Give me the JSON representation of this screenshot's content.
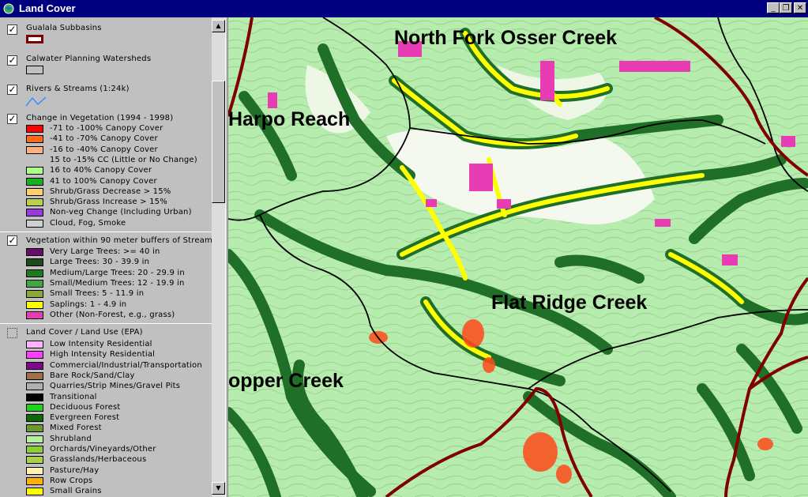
{
  "window": {
    "title": "Land Cover",
    "controls": [
      "_",
      "❐",
      "✕"
    ]
  },
  "legend": {
    "groups": [
      {
        "title": "Gualala Subbasins",
        "checked": true,
        "symbol": "subbasin-box",
        "color": "#800000"
      },
      {
        "title": "Calwater Planning Watersheds",
        "checked": true,
        "symbol": "watershed-box",
        "color": "#000000"
      },
      {
        "title": "Rivers & Streams (1:24k)",
        "checked": true,
        "symbol": "stream-line",
        "color": "#3b8dff"
      },
      {
        "title": "Change in Vegetation (1994 - 1998)",
        "checked": true,
        "items": [
          {
            "label": "-71 to -100% Canopy Cover",
            "color": "#ff0000"
          },
          {
            "label": "-41 to -70% Canopy Cover",
            "color": "#ff6a1a"
          },
          {
            "label": "-16 to -40% Canopy Cover",
            "color": "#ffb080"
          },
          {
            "label": "15 to -15% CC (Little or No Change)",
            "color": ""
          },
          {
            "label": "16 to 40% Canopy Cover",
            "color": "#aaff88"
          },
          {
            "label": "41 to 100% Canopy Cover",
            "color": "#19b01e"
          },
          {
            "label": "Shrub/Grass Decrease > 15%",
            "color": "#ffd06a"
          },
          {
            "label": "Shrub/Grass Increase > 15%",
            "color": "#b9cf4e"
          },
          {
            "label": "Non-veg Change (Including Urban)",
            "color": "#9a38e0"
          },
          {
            "label": "Cloud, Fog, Smoke",
            "color": "#d0d0d0"
          }
        ]
      },
      {
        "title": "Vegetation within 90 meter buffers of Streams",
        "checked": true,
        "items": [
          {
            "label": "Very Large Trees: >= 40  in",
            "color": "#6a0a6a"
          },
          {
            "label": "Large Trees: 30 - 39.9 in",
            "color": "#1c4a1c"
          },
          {
            "label": "Medium/Large Trees: 20 - 29.9 in",
            "color": "#1f7a1f"
          },
          {
            "label": "Small/Medium Trees: 12 - 19.9 in",
            "color": "#3fa73f"
          },
          {
            "label": "Small Trees: 5 - 11.9 in",
            "color": "#8ca83a"
          },
          {
            "label": "Saplings: 1 - 4.9 in",
            "color": "#ffff00"
          },
          {
            "label": "Other (Non-Forest, e.g., grass)",
            "color": "#e83cb4"
          }
        ]
      },
      {
        "title": "Land Cover / Land Use (EPA)",
        "checked": false,
        "items": [
          {
            "label": "Low Intensity Residential",
            "color": "#ffb4ff"
          },
          {
            "label": "High Intensity Residential",
            "color": "#ff3cff"
          },
          {
            "label": "Commercial/Industrial/Transportation",
            "color": "#7a0a8a"
          },
          {
            "label": "Bare Rock/Sand/Clay",
            "color": "#a0704a"
          },
          {
            "label": "Quarries/Strip Mines/Gravel Pits",
            "color": "#b0b0b0"
          },
          {
            "label": "Transitional",
            "color": "#000000"
          },
          {
            "label": "Deciduous Forest",
            "color": "#1fd01f"
          },
          {
            "label": "Evergreen Forest",
            "color": "#0a6a0a"
          },
          {
            "label": "Mixed Forest",
            "color": "#6a9a2a"
          },
          {
            "label": "Shrubland",
            "color": "#b4f0a0"
          },
          {
            "label": "Orchards/Vineyards/Other",
            "color": "#8ccf30"
          },
          {
            "label": "Grasslands/Herbaceous",
            "color": "#a8d24a"
          },
          {
            "label": "Pasture/Hay",
            "color": "#fff0b4"
          },
          {
            "label": "Row Crops",
            "color": "#ffb000"
          },
          {
            "label": "Small Grains",
            "color": "#ffff00"
          }
        ]
      }
    ]
  },
  "map": {
    "labels": {
      "north_fork": "North Fork Osser Creek",
      "harpo": "Harpo Reach",
      "flat_ridge": "Flat Ridge Creek",
      "copper": "opper Creek"
    },
    "colors": {
      "background": "#b6ecae",
      "subbasin": "#800000",
      "watershed": "#000000",
      "saplings": "#ffff00",
      "trees_dark": "#1f6f28",
      "trees_medium": "#3fa73f",
      "other": "#e83cb4",
      "loss": "#ff4a1a"
    }
  }
}
